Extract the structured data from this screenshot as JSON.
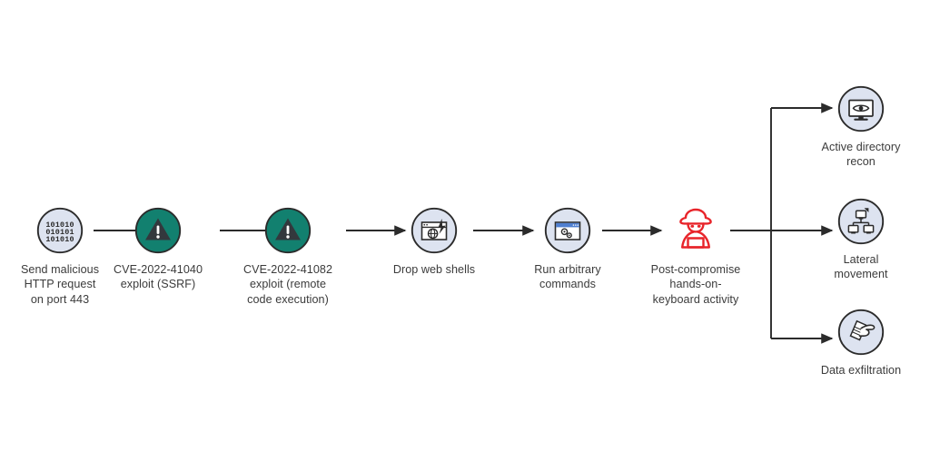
{
  "diagram": {
    "type": "attack-chain-flow",
    "colors": {
      "icon_fill_blue": "#dde3f0",
      "icon_fill_teal": "#12806f",
      "icon_stroke_dark": "#2b2b2b",
      "attacker_red": "#e8242a",
      "arrow": "#2b2b2b",
      "text": "#3b3b3b",
      "window_titlebar_blue": "#4f7fd0"
    },
    "chain": [
      {
        "id": "send-malicious-http-request",
        "label": "Send malicious\nHTTP request\non port 443",
        "icon": "binary-code-icon",
        "icon_style": "blue",
        "binary_rows": [
          "101010",
          "010101",
          "101010"
        ]
      },
      {
        "id": "cve-2022-41040-exploit",
        "label": "CVE-2022-41040\nexploit (SSRF)",
        "icon": "warning-triangle-icon",
        "icon_style": "teal"
      },
      {
        "id": "cve-2022-41082-exploit",
        "label": "CVE-2022-41082\nexploit (remote\ncode execution)",
        "icon": "warning-triangle-icon",
        "icon_style": "teal"
      },
      {
        "id": "drop-web-shells",
        "label": "Drop web shells",
        "icon": "web-shell-icon",
        "icon_style": "blue"
      },
      {
        "id": "run-arbitrary-commands",
        "label": "Run arbitrary\ncommands",
        "icon": "window-gears-icon",
        "icon_style": "blue"
      },
      {
        "id": "post-compromise-activity",
        "label": "Post-compromise\nhands-on-\nkeyboard activity",
        "icon": "attacker-hacker-icon",
        "icon_style": "red-outline"
      }
    ],
    "branches": [
      {
        "id": "active-directory-recon",
        "label": "Active directory\nrecon",
        "icon": "monitor-eye-icon",
        "icon_style": "blue"
      },
      {
        "id": "lateral-movement",
        "label": "Lateral\nmovement",
        "icon": "network-topology-icon",
        "icon_style": "blue"
      },
      {
        "id": "data-exfiltration",
        "label": "Data exfiltration",
        "icon": "hand-documents-icon",
        "icon_style": "blue"
      }
    ]
  }
}
